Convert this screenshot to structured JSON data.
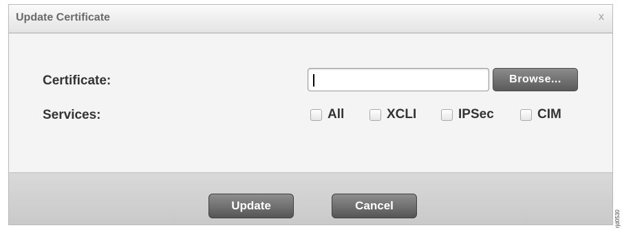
{
  "dialog": {
    "title": "Update Certificate",
    "close_glyph": "x"
  },
  "form": {
    "certificate_label": "Certificate:",
    "certificate_value": "",
    "browse_label": "Browse...",
    "services_label": "Services:",
    "services": [
      {
        "label": "All",
        "checked": false
      },
      {
        "label": "XCLI",
        "checked": false
      },
      {
        "label": "IPSec",
        "checked": false
      },
      {
        "label": "CIM",
        "checked": false
      }
    ]
  },
  "footer": {
    "update_label": "Update",
    "cancel_label": "Cancel"
  },
  "figure_id": "rjd0530"
}
